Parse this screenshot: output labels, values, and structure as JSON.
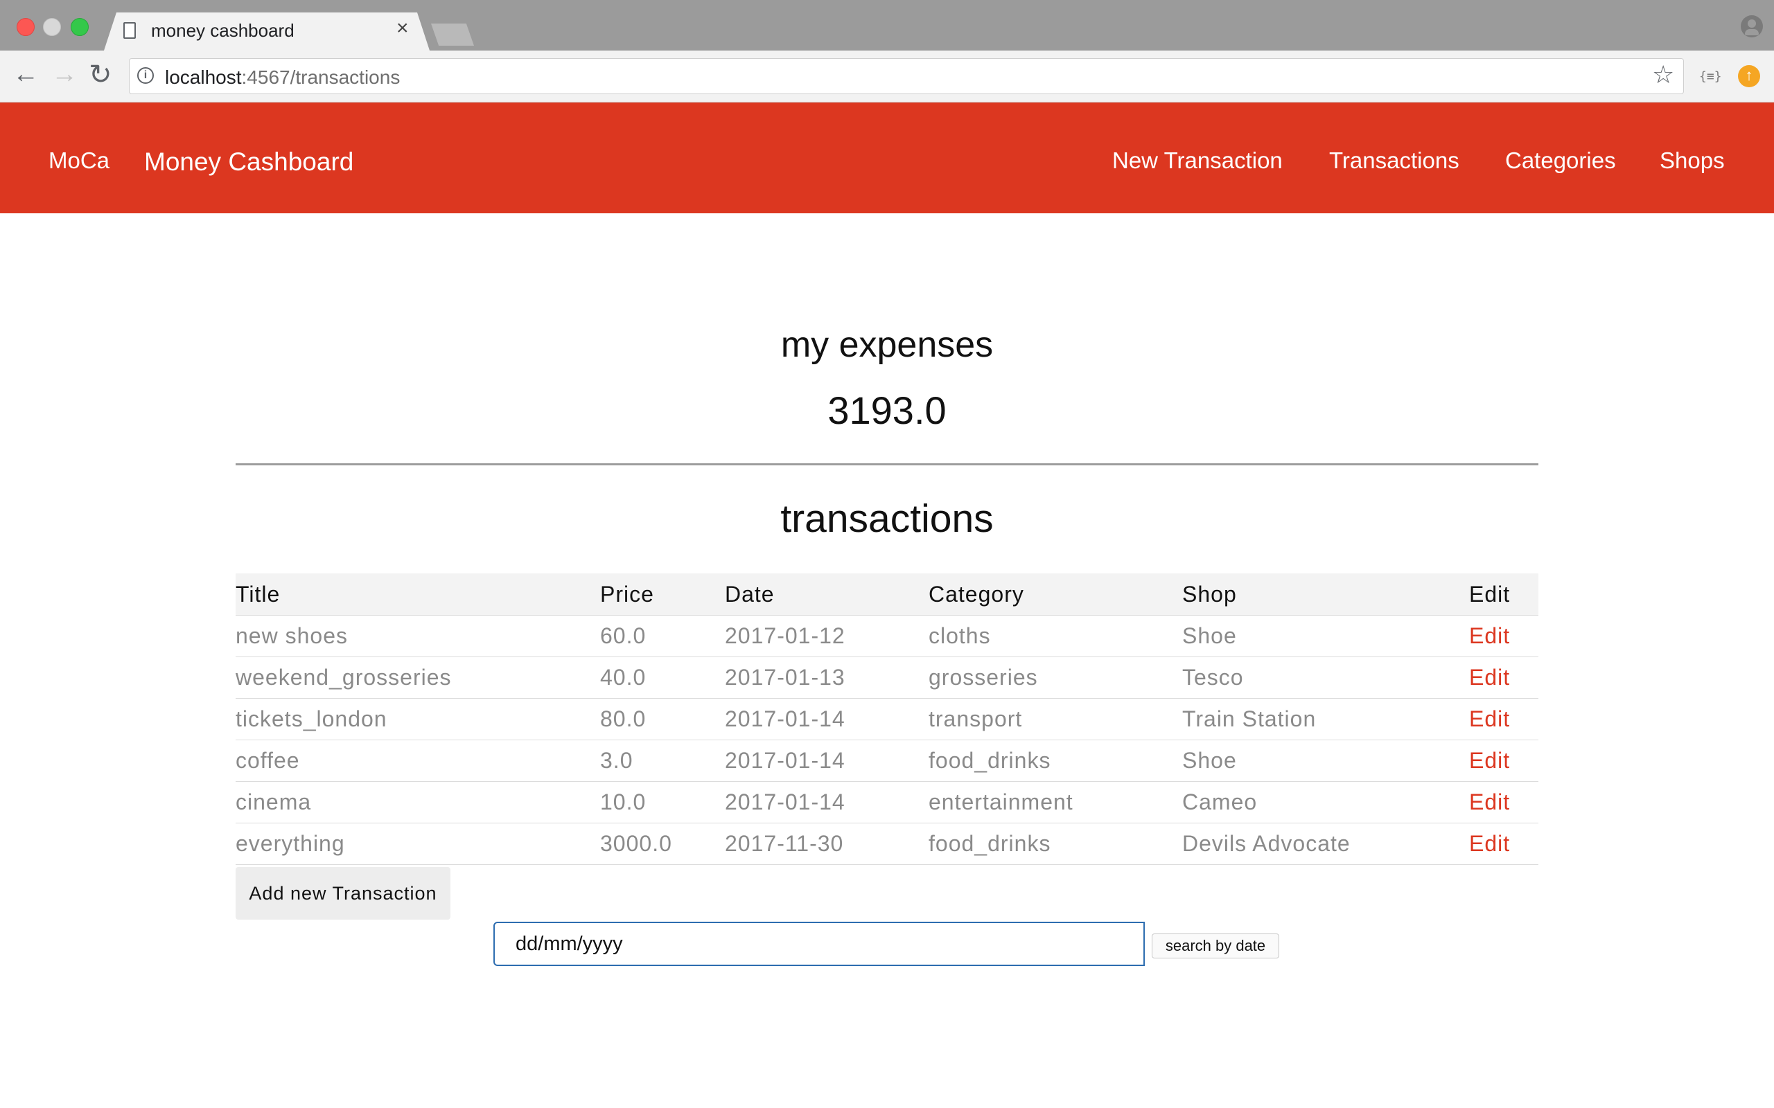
{
  "browser": {
    "tab_title": "money cashboard",
    "tab_close": "×",
    "url_host": "localhost",
    "url_rest": ":4567/transactions",
    "icons": [
      "doc-icon",
      "close-icon",
      "back-icon",
      "forward-icon",
      "reload-icon",
      "info-icon",
      "star-icon",
      "extension-icon",
      "profile-icon"
    ]
  },
  "header": {
    "brand": "MoCa",
    "subtitle": "Money Cashboard",
    "nav": {
      "new_transaction": "New Transaction",
      "transactions": "Transactions",
      "categories": "Categories",
      "shops": "Shops"
    },
    "color": "#dc3720"
  },
  "summary": {
    "heading": "my expenses",
    "total": "3193.0"
  },
  "transactions": {
    "heading": "transactions",
    "columns": [
      "Title",
      "Price",
      "Date",
      "Category",
      "Shop",
      "Edit"
    ],
    "rows": [
      {
        "title": "new shoes",
        "price": "60.0",
        "date": "2017-01-12",
        "category": "cloths",
        "shop": "Shoe",
        "edit": "Edit"
      },
      {
        "title": "weekend_grosseries",
        "price": "40.0",
        "date": "2017-01-13",
        "category": "grosseries",
        "shop": "Tesco",
        "edit": "Edit"
      },
      {
        "title": "tickets_london",
        "price": "80.0",
        "date": "2017-01-14",
        "category": "transport",
        "shop": "Train Station",
        "edit": "Edit"
      },
      {
        "title": "coffee",
        "price": "3.0",
        "date": "2017-01-14",
        "category": "food_drinks",
        "shop": "Shoe",
        "edit": "Edit"
      },
      {
        "title": "cinema",
        "price": "10.0",
        "date": "2017-01-14",
        "category": "entertainment",
        "shop": "Cameo",
        "edit": "Edit"
      },
      {
        "title": "everything",
        "price": "3000.0",
        "date": "2017-11-30",
        "category": "food_drinks",
        "shop": "Devils Advocate",
        "edit": "Edit"
      }
    ],
    "add_button": "Add new Transaction"
  },
  "search": {
    "placeholder": "dd/mm/yyyy",
    "button": "search by date"
  }
}
